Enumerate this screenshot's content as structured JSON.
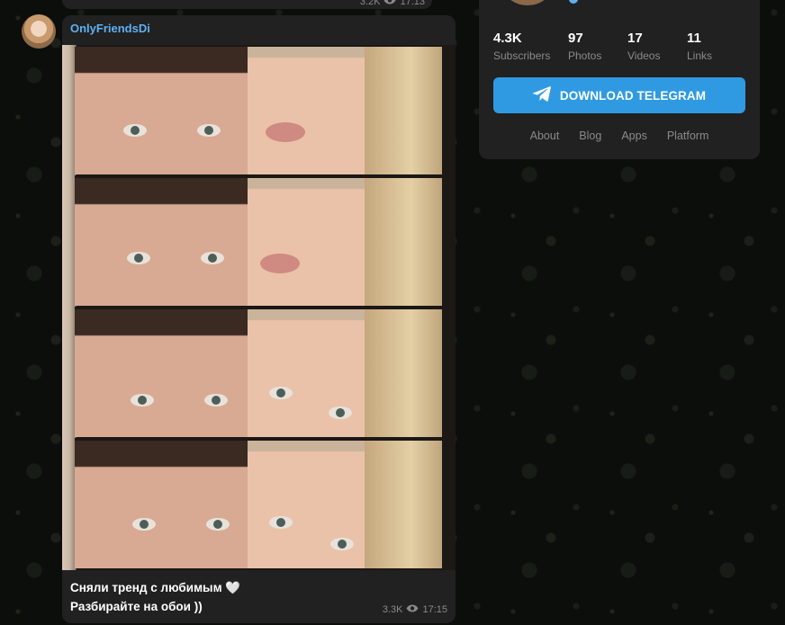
{
  "previous_message": {
    "views": "3.2K",
    "time": "17:13"
  },
  "message": {
    "author": "OnlyFriendsDi",
    "text_line1": "Сняли тренд с любимым 🤍",
    "text_line2": "Разбирайте на обои ))",
    "views": "3.3K",
    "time": "17:15"
  },
  "channel_card": {
    "stats": [
      {
        "value": "4.3K",
        "label": "Subscribers"
      },
      {
        "value": "97",
        "label": "Photos"
      },
      {
        "value": "17",
        "label": "Videos"
      },
      {
        "value": "11",
        "label": "Links"
      }
    ],
    "download_button": "DOWNLOAD TELEGRAM",
    "links": [
      "About",
      "Blog",
      "Apps",
      "Platform"
    ]
  },
  "colors": {
    "accent_blue": "#2f9ae2",
    "author_blue": "#5fb0f0",
    "bubble_bg": "#212121",
    "muted_text": "#8a8a8a"
  },
  "icons": {
    "views": "eye-icon",
    "download": "telegram-plane-icon"
  }
}
